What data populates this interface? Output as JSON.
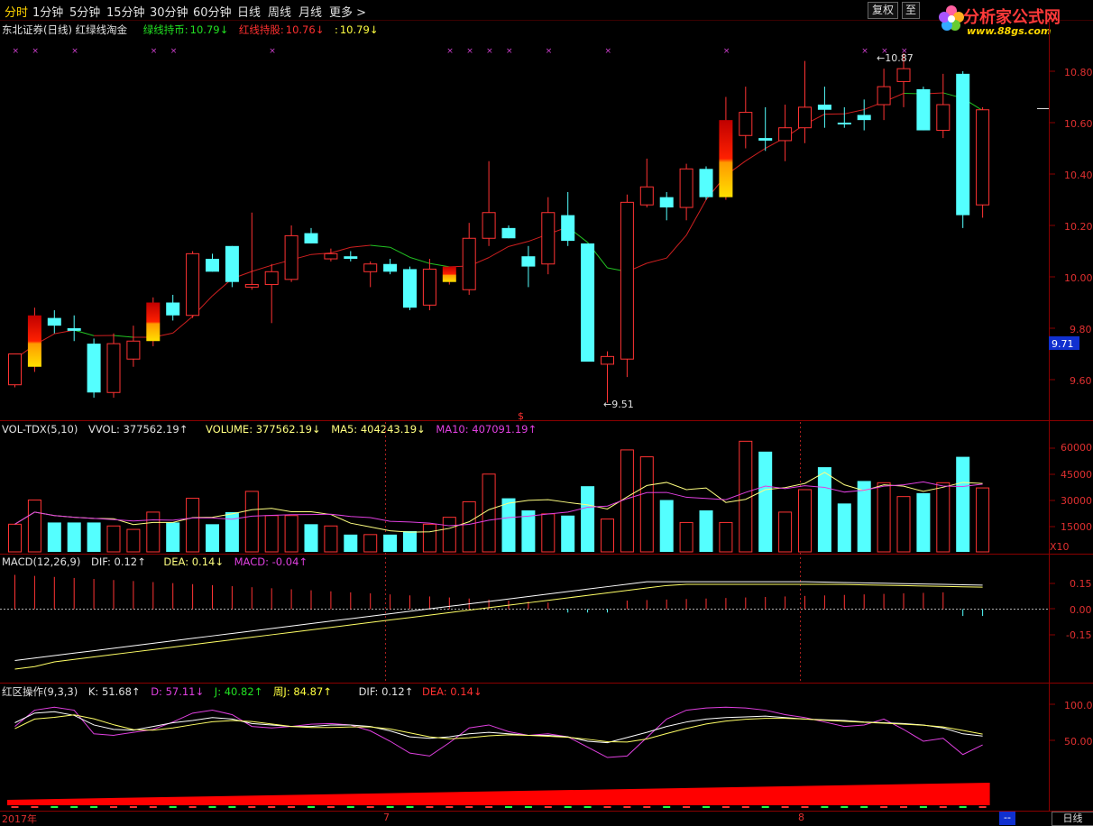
{
  "toolbar": {
    "periods": [
      "分时",
      "1分钟",
      "5分钟",
      "15分钟",
      "30分钟",
      "60分钟",
      "日线",
      "周线",
      "月线",
      "更多 >"
    ],
    "active": "日线",
    "btn_fq": "复权",
    "btn_sel": "至"
  },
  "logo": {
    "title": "分析家公式网",
    "url": "www.88gs.com"
  },
  "price_panel": {
    "name": "东北证券(日线) 红绿线淘金",
    "g_label": "绿线持币:",
    "g_val": "10.79↓",
    "r_label": "红线持股:",
    "r_val": "10.76↓",
    "x_label": ":",
    "x_val": "10.79↓",
    "hi_label": "10.87",
    "lo_label": "9.51",
    "cur_tag": "9.71",
    "s_mark": "$",
    "yticks": [
      "10.80",
      "10.60",
      "10.40",
      "10.20",
      "10.00",
      "9.80",
      "9.60"
    ]
  },
  "vol_panel": {
    "name": "VOL-TDX(5,10)",
    "vvol": "VVOL: 377562.19↑",
    "volume": "VOLUME: 377562.19↓",
    "ma5": "MA5: 404243.19↓",
    "ma10": "MA10: 407091.19↑",
    "yticks": [
      "60000",
      "45000",
      "30000",
      "15000"
    ],
    "unit": "X10"
  },
  "macd_panel": {
    "name": "MACD(12,26,9)",
    "dif": "DIF: 0.12↑",
    "dea": "DEA: 0.14↓",
    "macd": "MACD: -0.04↑",
    "yticks": [
      "0.15",
      "0.00",
      "-0.15"
    ]
  },
  "kdj_panel": {
    "name": "红区操作(9,3,3)",
    "k": "K: 51.68↑",
    "d": "D: 57.11↓",
    "j": "J: 40.82↑",
    "wj": "周J: 84.87↑",
    "dif": "DIF: 0.12↑",
    "dea": "DEA: 0.14↓",
    "yticks": [
      "100.0",
      "50.00"
    ]
  },
  "date_axis": {
    "year": "2017年",
    "m7": "7",
    "m8": "8",
    "dash": "--",
    "btn": "日线"
  },
  "colors": {
    "up": "#ff3333",
    "down": "#54ffff",
    "ma_green": "#22c222",
    "ma_red": "#d02020",
    "magenta": "#e040e0",
    "yellow": "#ffff66"
  },
  "chart_data": {
    "type": "candlestick",
    "ylim": [
      9.5,
      10.9
    ],
    "candles": [
      {
        "o": 9.58,
        "h": 9.68,
        "l": 9.57,
        "c": 9.7,
        "u": true,
        "sig": false
      },
      {
        "o": 9.65,
        "h": 9.88,
        "l": 9.63,
        "c": 9.85,
        "u": true,
        "sig": true
      },
      {
        "o": 9.81,
        "h": 9.87,
        "l": 9.78,
        "c": 9.84,
        "u": false,
        "sig": false
      },
      {
        "o": 9.8,
        "h": 9.85,
        "l": 9.75,
        "c": 9.79,
        "u": false,
        "sig": false
      },
      {
        "o": 9.74,
        "h": 9.76,
        "l": 9.53,
        "c": 9.55,
        "u": false,
        "sig": false
      },
      {
        "o": 9.55,
        "h": 9.78,
        "l": 9.53,
        "c": 9.74,
        "u": true,
        "sig": false
      },
      {
        "o": 9.68,
        "h": 9.81,
        "l": 9.65,
        "c": 9.75,
        "u": true,
        "sig": false
      },
      {
        "o": 9.75,
        "h": 9.92,
        "l": 9.73,
        "c": 9.9,
        "u": true,
        "sig": true
      },
      {
        "o": 9.9,
        "h": 9.93,
        "l": 9.83,
        "c": 9.85,
        "u": false,
        "sig": false
      },
      {
        "o": 9.85,
        "h": 10.1,
        "l": 9.84,
        "c": 10.09,
        "u": true,
        "sig": false
      },
      {
        "o": 10.07,
        "h": 10.09,
        "l": 10.02,
        "c": 10.02,
        "u": false,
        "sig": false
      },
      {
        "o": 10.12,
        "h": 10.12,
        "l": 9.96,
        "c": 9.98,
        "u": false,
        "sig": false
      },
      {
        "o": 9.96,
        "h": 10.25,
        "l": 9.95,
        "c": 9.97,
        "u": true,
        "sig": false
      },
      {
        "o": 9.97,
        "h": 10.05,
        "l": 9.82,
        "c": 10.02,
        "u": true,
        "sig": false
      },
      {
        "o": 9.99,
        "h": 10.2,
        "l": 9.98,
        "c": 10.16,
        "u": true,
        "sig": false
      },
      {
        "o": 10.17,
        "h": 10.19,
        "l": 10.13,
        "c": 10.13,
        "u": false,
        "sig": false
      },
      {
        "o": 10.07,
        "h": 10.11,
        "l": 10.06,
        "c": 10.09,
        "u": true,
        "sig": false
      },
      {
        "o": 10.08,
        "h": 10.1,
        "l": 10.06,
        "c": 10.07,
        "u": false,
        "sig": false
      },
      {
        "o": 10.02,
        "h": 10.06,
        "l": 9.96,
        "c": 10.05,
        "u": true,
        "sig": false
      },
      {
        "o": 10.05,
        "h": 10.07,
        "l": 10.01,
        "c": 10.02,
        "u": false,
        "sig": false
      },
      {
        "o": 10.03,
        "h": 10.04,
        "l": 9.87,
        "c": 9.88,
        "u": false,
        "sig": false
      },
      {
        "o": 9.89,
        "h": 10.07,
        "l": 9.87,
        "c": 10.03,
        "u": true,
        "sig": false
      },
      {
        "o": 9.98,
        "h": 10.04,
        "l": 9.97,
        "c": 10.04,
        "u": true,
        "sig": true
      },
      {
        "o": 9.95,
        "h": 10.21,
        "l": 9.93,
        "c": 10.15,
        "u": true,
        "sig": false
      },
      {
        "o": 10.15,
        "h": 10.45,
        "l": 10.12,
        "c": 10.25,
        "u": true,
        "sig": false
      },
      {
        "o": 10.19,
        "h": 10.2,
        "l": 10.15,
        "c": 10.15,
        "u": false,
        "sig": false
      },
      {
        "o": 10.08,
        "h": 10.12,
        "l": 9.96,
        "c": 10.04,
        "u": false,
        "sig": false
      },
      {
        "o": 10.05,
        "h": 10.31,
        "l": 10.01,
        "c": 10.25,
        "u": true,
        "sig": false
      },
      {
        "o": 10.24,
        "h": 10.33,
        "l": 10.12,
        "c": 10.14,
        "u": false,
        "sig": false
      },
      {
        "o": 10.13,
        "h": 10.13,
        "l": 9.68,
        "c": 9.67,
        "u": false,
        "sig": false
      },
      {
        "o": 9.66,
        "h": 9.71,
        "l": 9.51,
        "c": 9.69,
        "u": true,
        "sig": false
      },
      {
        "o": 9.68,
        "h": 10.32,
        "l": 9.61,
        "c": 10.29,
        "u": true,
        "sig": false
      },
      {
        "o": 10.28,
        "h": 10.46,
        "l": 10.27,
        "c": 10.35,
        "u": true,
        "sig": false
      },
      {
        "o": 10.31,
        "h": 10.33,
        "l": 10.22,
        "c": 10.27,
        "u": false,
        "sig": false
      },
      {
        "o": 10.27,
        "h": 10.44,
        "l": 10.22,
        "c": 10.42,
        "u": true,
        "sig": false
      },
      {
        "o": 10.42,
        "h": 10.43,
        "l": 10.3,
        "c": 10.31,
        "u": false,
        "sig": false
      },
      {
        "o": 10.31,
        "h": 10.7,
        "l": 10.3,
        "c": 10.61,
        "u": true,
        "sig": true
      },
      {
        "o": 10.55,
        "h": 10.74,
        "l": 10.5,
        "c": 10.64,
        "u": true,
        "sig": false
      },
      {
        "o": 10.54,
        "h": 10.66,
        "l": 10.49,
        "c": 10.53,
        "u": false,
        "sig": false
      },
      {
        "o": 10.53,
        "h": 10.67,
        "l": 10.45,
        "c": 10.58,
        "u": true,
        "sig": false
      },
      {
        "o": 10.58,
        "h": 10.84,
        "l": 10.52,
        "c": 10.66,
        "u": true,
        "sig": false
      },
      {
        "o": 10.67,
        "h": 10.74,
        "l": 10.58,
        "c": 10.65,
        "u": false,
        "sig": false
      },
      {
        "o": 10.6,
        "h": 10.66,
        "l": 10.58,
        "c": 10.6,
        "u": false,
        "sig": false
      },
      {
        "o": 10.63,
        "h": 10.69,
        "l": 10.57,
        "c": 10.61,
        "u": false,
        "sig": false
      },
      {
        "o": 10.67,
        "h": 10.81,
        "l": 10.61,
        "c": 10.74,
        "u": true,
        "sig": false
      },
      {
        "o": 10.76,
        "h": 10.87,
        "l": 10.66,
        "c": 10.81,
        "u": true,
        "sig": false
      },
      {
        "o": 10.73,
        "h": 10.74,
        "l": 10.57,
        "c": 10.57,
        "u": false,
        "sig": false
      },
      {
        "o": 10.57,
        "h": 10.79,
        "l": 10.54,
        "c": 10.67,
        "u": true,
        "sig": false
      },
      {
        "o": 10.79,
        "h": 10.8,
        "l": 10.19,
        "c": 10.24,
        "u": false,
        "sig": false
      },
      {
        "o": 10.28,
        "h": 10.66,
        "l": 10.23,
        "c": 10.65,
        "u": true,
        "sig": false
      }
    ],
    "volume": [
      16,
      30,
      17,
      17,
      17,
      15,
      13,
      23,
      17,
      31,
      16,
      23,
      35,
      21,
      21,
      16,
      15,
      10,
      10,
      10,
      12,
      16,
      20,
      29,
      45,
      31,
      24,
      22,
      21,
      38,
      19,
      59,
      55,
      30,
      17,
      24,
      17,
      64,
      58,
      23,
      36,
      49,
      28,
      41,
      40,
      32,
      34,
      40,
      55,
      37
    ],
    "vol_ylim": [
      0,
      70000
    ]
  }
}
